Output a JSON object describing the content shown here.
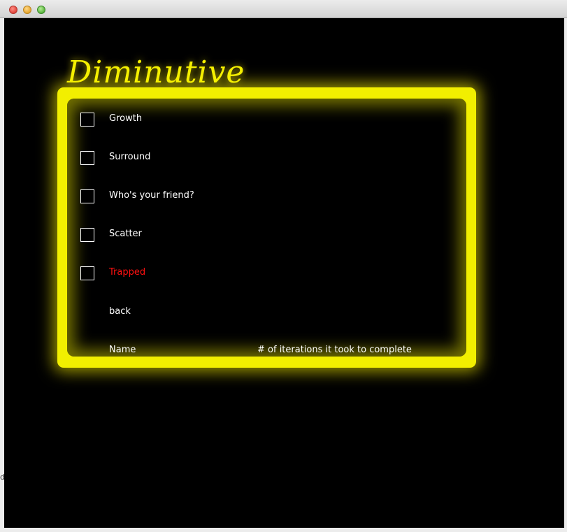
{
  "app": {
    "title": "Diminutive"
  },
  "side_fragment": "d",
  "levels": [
    {
      "label": "Growth",
      "checked": false,
      "color": "#ffffff"
    },
    {
      "label": "Surround",
      "checked": false,
      "color": "#ffffff"
    },
    {
      "label": "Who's your friend?",
      "checked": false,
      "color": "#ffffff"
    },
    {
      "label": "Scatter",
      "checked": false,
      "color": "#ffffff"
    },
    {
      "label": "Trapped",
      "checked": false,
      "color": "#ff1010"
    }
  ],
  "back_label": "back",
  "table": {
    "headers": [
      "Name",
      "# of iterations it took to complete"
    ]
  },
  "colors": {
    "neon": "#f2ef00",
    "background": "#000000",
    "text": "#ffffff",
    "highlight": "#ff1010"
  }
}
